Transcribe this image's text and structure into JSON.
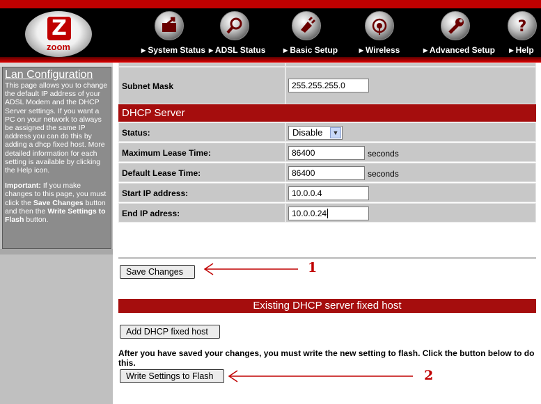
{
  "brand": {
    "logo_letter": "Z",
    "logo_text": "zoom"
  },
  "nav": [
    {
      "label": "System Status",
      "icon": "folder-arrow-icon"
    },
    {
      "label": "ADSL Status",
      "icon": "magnifier-icon"
    },
    {
      "label": "Basic Setup",
      "icon": "plug-icon"
    },
    {
      "label": "Wireless",
      "icon": "wireless-icon"
    },
    {
      "label": "Advanced Setup",
      "icon": "wrench-icon"
    },
    {
      "label": "Help",
      "icon": "question-icon"
    }
  ],
  "sidebar": {
    "title": "Lan Configuration",
    "intro": "This page allows you to change the default IP address of your ADSL Modem and the DHCP Server settings. If you want a PC on your network to always be assigned the same IP address you can do this by adding a dhcp fixed host. More detailed information for each setting is available by clicking the Help icon.",
    "important_label": "Important:",
    "important_1": " If you make changes to this page, you must click the ",
    "save_changes_ref": "Save Changes",
    "important_2": " button and then the ",
    "write_ref": "Write Settings to Flash",
    "important_3": " button."
  },
  "form": {
    "subnet_mask_label": "Subnet Mask",
    "subnet_mask_value": "255.255.255.0",
    "dhcp_header": "DHCP Server",
    "status_label": "Status:",
    "status_value": "Disable",
    "max_lease_label": "Maximum Lease Time:",
    "max_lease_value": "86400",
    "default_lease_label": "Default Lease Time:",
    "default_lease_value": "86400",
    "seconds_unit": "seconds",
    "start_ip_label": "Start IP address:",
    "start_ip_value": "10.0.0.4",
    "end_ip_label": "End IP adress:",
    "end_ip_value": "10.0.0.24"
  },
  "actions": {
    "save_changes": "Save Changes",
    "fixed_host_header": "Existing DHCP server fixed host",
    "add_fixed_host": "Add DHCP fixed host",
    "flash_note": "After you have saved your changes, you must write the new setting to flash. Click the button below to do this.",
    "write_flash": "Write Settings to Flash"
  },
  "annotations": {
    "marker_1": "1",
    "marker_2": "2"
  },
  "colors": {
    "brand_red": "#c00000",
    "section_red": "#a50d0d",
    "sidebar_gray": "#8c8c8c"
  }
}
